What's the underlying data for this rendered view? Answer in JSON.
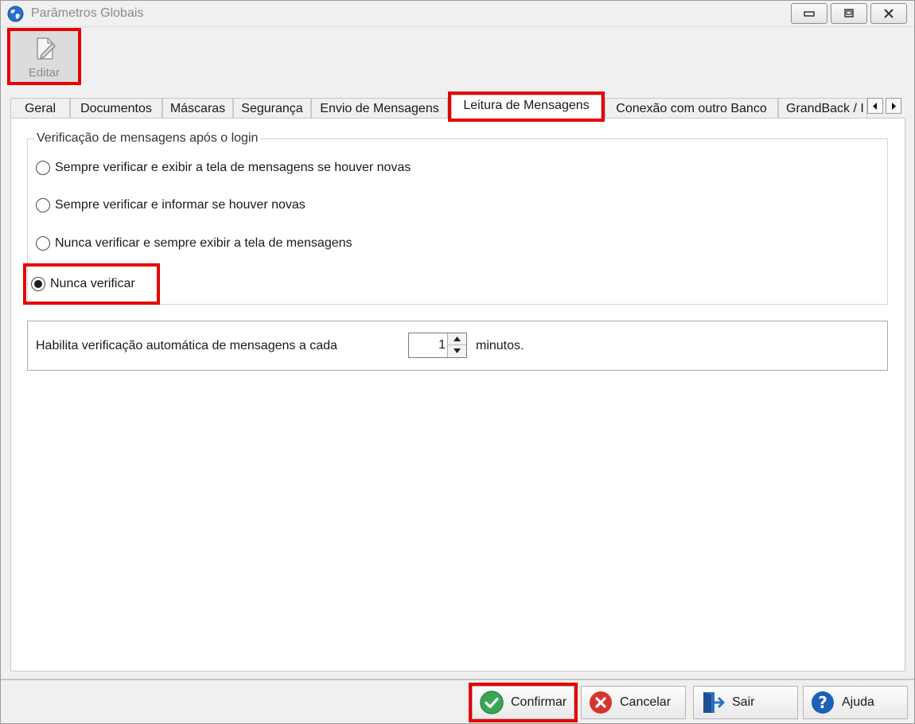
{
  "window": {
    "title": "Parâmetros Globais"
  },
  "toolbar": {
    "edit_label": "Editar"
  },
  "tabs": [
    {
      "label": "Geral"
    },
    {
      "label": "Documentos"
    },
    {
      "label": "Máscaras"
    },
    {
      "label": "Segurança"
    },
    {
      "label": "Envio de Mensagens"
    },
    {
      "label": "Leitura de Mensagens",
      "active": true
    },
    {
      "label": "Conexão com outro Banco"
    },
    {
      "label": "GrandBack / I"
    }
  ],
  "login_check": {
    "legend": "Verificação de mensagens após o login",
    "options": [
      {
        "label": "Sempre verificar e exibir a tela de mensagens se houver novas",
        "checked": false
      },
      {
        "label": "Sempre verificar e informar se houver novas",
        "checked": false
      },
      {
        "label": "Nunca verificar e sempre exibir a tela de mensagens",
        "checked": false
      },
      {
        "label": "Nunca verificar",
        "checked": true
      }
    ]
  },
  "auto_check": {
    "label": "Habilita verificação automática de mensagens a cada",
    "value": "1",
    "unit": "minutos."
  },
  "buttons": {
    "confirm": "Confirmar",
    "cancel": "Cancelar",
    "exit": "Sair",
    "help": "Ajuda"
  },
  "colors": {
    "highlight": "#e60000",
    "confirm_green": "#3aa655",
    "cancel_red": "#d9342b",
    "help_blue": "#1e5fb8",
    "exit_blue": "#2a6fc9"
  }
}
